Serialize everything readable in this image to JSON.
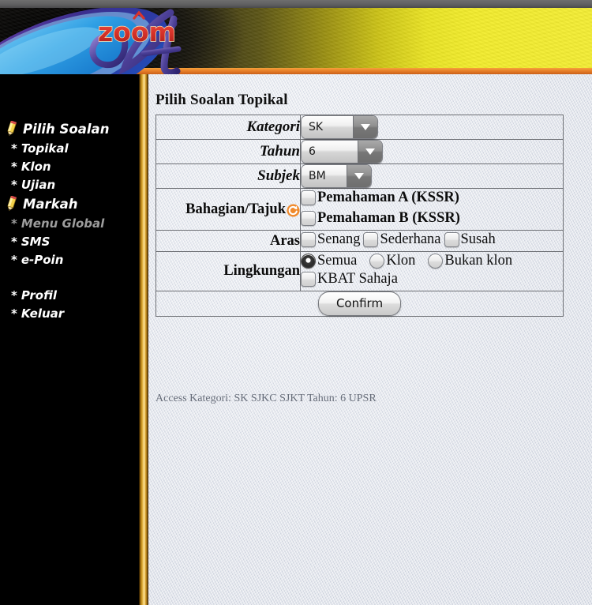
{
  "brand": {
    "logo_text": "zoom",
    "logo_script": "A",
    "logo_red": "#d9342b",
    "logo_purple": "#4b3f96",
    "banner_yellow": "#f2ec2e",
    "banner_border_orange": "#e8802a"
  },
  "sidebar": {
    "items": [
      {
        "label": "Pilih Soalan",
        "type": "head",
        "icon": "pencil-icon",
        "dim": false
      },
      {
        "label": "Topikal",
        "type": "sub",
        "icon": "star-bullet",
        "dim": false
      },
      {
        "label": "Klon",
        "type": "sub",
        "icon": "star-bullet",
        "dim": false
      },
      {
        "label": "Ujian",
        "type": "sub",
        "icon": "star-bullet",
        "dim": false
      },
      {
        "label": "Markah",
        "type": "head",
        "icon": "pencil-icon",
        "dim": false
      },
      {
        "label": "Menu Global",
        "type": "sub",
        "icon": "star-bullet",
        "dim": true
      },
      {
        "label": "SMS",
        "type": "sub",
        "icon": "star-bullet",
        "dim": false
      },
      {
        "label": "e-Poin",
        "type": "sub",
        "icon": "star-bullet",
        "dim": false
      },
      {
        "label": "Profil",
        "type": "sub",
        "icon": "star-bullet",
        "dim": false
      },
      {
        "label": "Keluar",
        "type": "sub",
        "icon": "star-bullet",
        "dim": false
      }
    ],
    "bullet": "*"
  },
  "main": {
    "title": "Pilih Soalan Topikal",
    "rows": {
      "kategori": {
        "label": "Kategori",
        "value": "SK"
      },
      "tahun": {
        "label": "Tahun",
        "value": "6"
      },
      "subjek": {
        "label": "Subjek",
        "value": "BM"
      },
      "bahagian": {
        "label": "Bahagian/Tajuk",
        "refresh_icon": "refresh-icon",
        "options": [
          {
            "label": "Pemahaman A (KSSR)",
            "checked": false
          },
          {
            "label": "Pemahaman B (KSSR)",
            "checked": false
          }
        ]
      },
      "aras": {
        "label": "Aras",
        "options": [
          {
            "label": "Senang",
            "checked": false
          },
          {
            "label": "Sederhana",
            "checked": false
          },
          {
            "label": "Susah",
            "checked": false
          }
        ]
      },
      "lingkungan": {
        "label": "Lingkungan",
        "radios": [
          {
            "label": "Semua",
            "selected": true
          },
          {
            "label": "Klon",
            "selected": false
          },
          {
            "label": "Bukan klon",
            "selected": false
          }
        ],
        "checkbox": {
          "label": "KBAT Sahaja",
          "checked": false
        }
      }
    },
    "confirm_label": "Confirm",
    "access_note": "Access Kategori: SK SJKC SJKT Tahun: 6 UPSR"
  }
}
